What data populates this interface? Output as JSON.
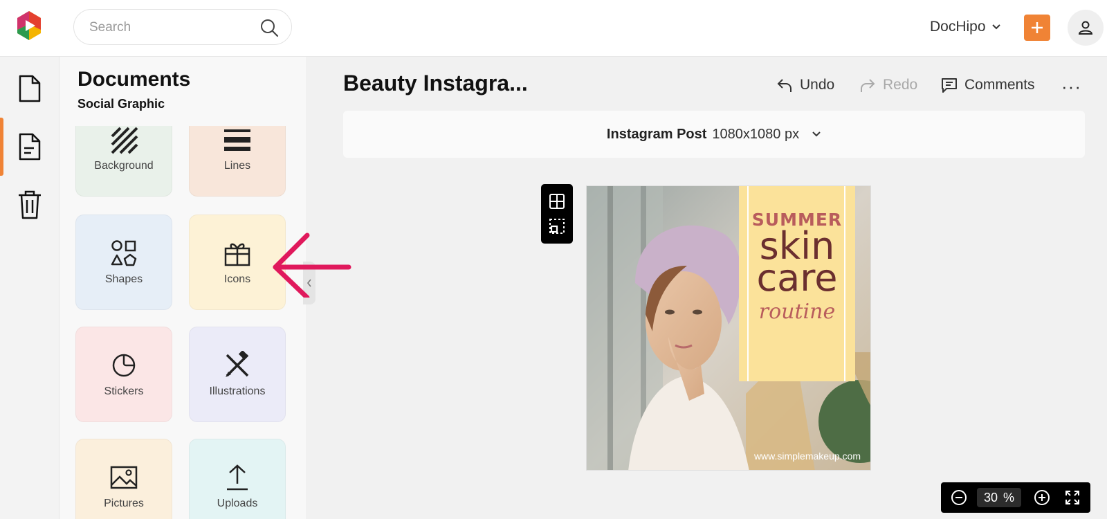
{
  "header": {
    "search_placeholder": "Search",
    "account_name": "DocHipo",
    "create_label": "+",
    "brand_colors": {
      "accent": "#f08335"
    }
  },
  "rail": {
    "items": [
      {
        "icon": "document-icon"
      },
      {
        "icon": "file-text-icon",
        "active": true
      },
      {
        "icon": "trash-icon"
      }
    ]
  },
  "panel": {
    "title": "Documents",
    "subtitle": "Social Graphic",
    "tiles": [
      {
        "label": "Background",
        "icon": "background-icon",
        "color": "#e9f1ea"
      },
      {
        "label": "Lines",
        "icon": "lines-icon",
        "color": "#f8e6da"
      },
      {
        "label": "Shapes",
        "icon": "shapes-icon",
        "color": "#e6eef7"
      },
      {
        "label": "Icons",
        "icon": "gift-icon",
        "color": "#fdf2d6"
      },
      {
        "label": "Stickers",
        "icon": "sticker-icon",
        "color": "#fbe6e6"
      },
      {
        "label": "Illustrations",
        "icon": "illustrations-icon",
        "color": "#ebebf8"
      },
      {
        "label": "Pictures",
        "icon": "picture-icon",
        "color": "#fbefdc"
      },
      {
        "label": "Uploads",
        "icon": "upload-icon",
        "color": "#e3f4f4"
      }
    ]
  },
  "editor": {
    "doc_title": "Beauty Instagra...",
    "undo_label": "Undo",
    "redo_label": "Redo",
    "comments_label": "Comments",
    "more_label": "···",
    "size_type": "Instagram Post",
    "size_dims": "1080x1080 px"
  },
  "design": {
    "line1": "SUMMER",
    "line2": "skin",
    "line3": "care",
    "line4": "routine",
    "url": "www.simplemakeup.com"
  },
  "zoom": {
    "value": "30",
    "unit": "%"
  }
}
